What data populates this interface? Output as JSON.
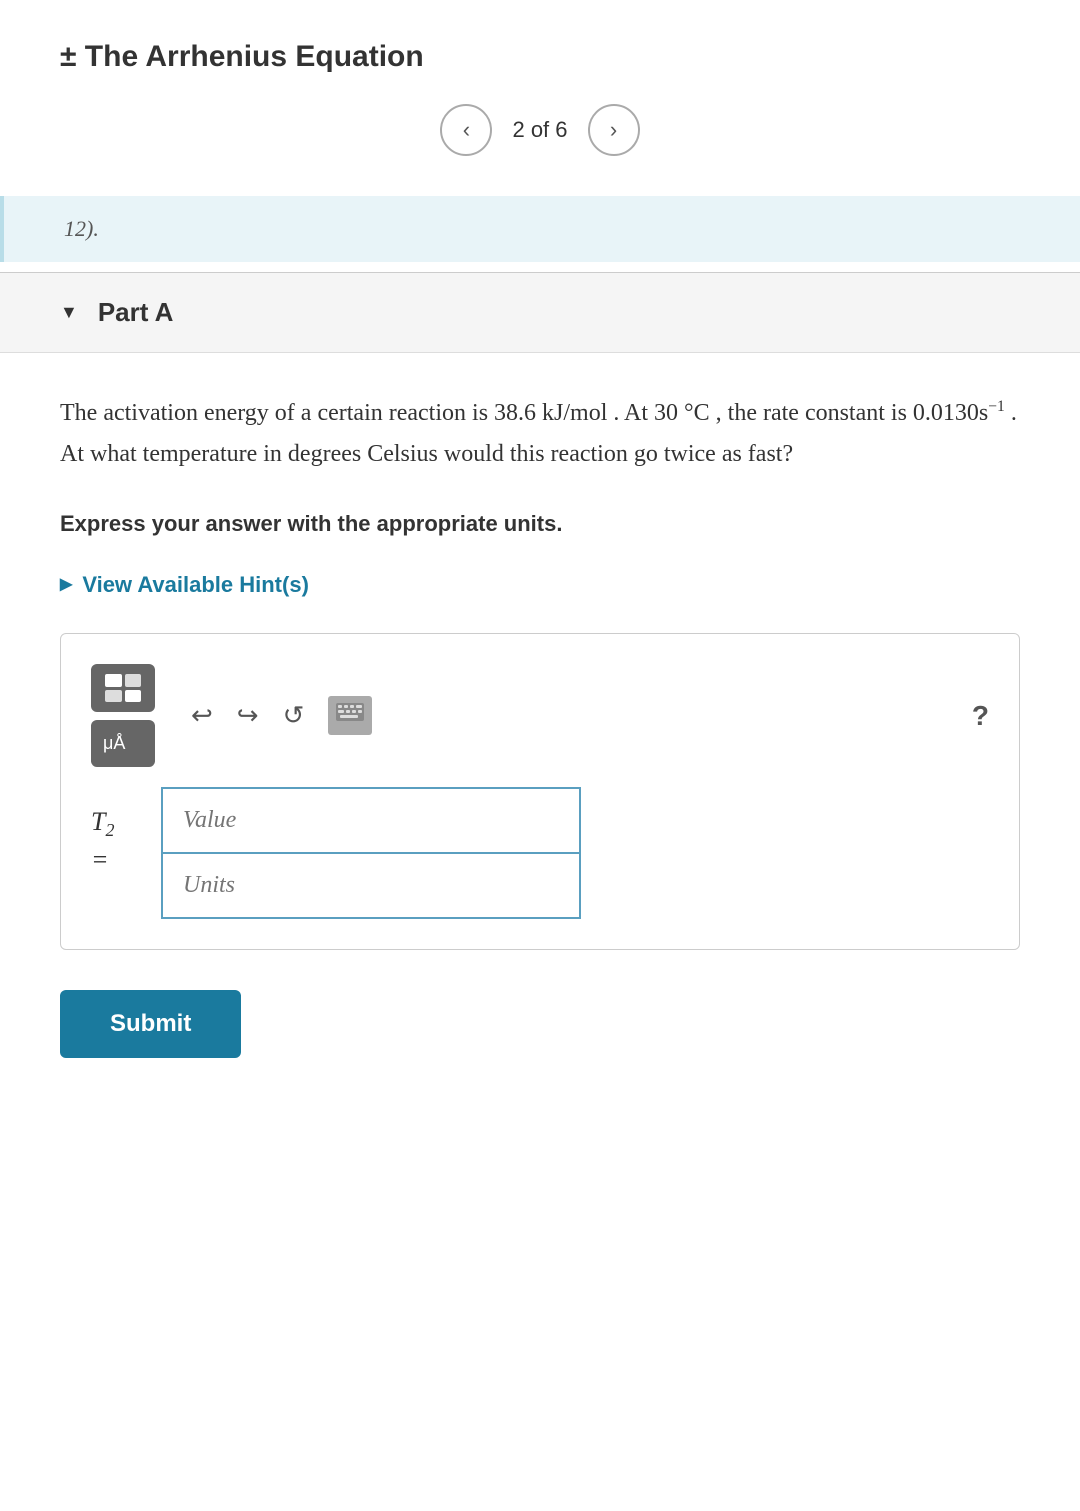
{
  "header": {
    "title": "± The Arrhenius Equation",
    "pagination": {
      "current": 2,
      "total": 6,
      "label": "2 of 6",
      "prev_label": "‹",
      "next_label": "›"
    }
  },
  "preview": {
    "text": "12)."
  },
  "part": {
    "label": "Part A",
    "question": {
      "main_text": "The activation energy of a certain reaction is 38.6 kJ/mol . At 30 °C , the rate constant is 0.0130s⁻¹ . At what temperature in degrees Celsius would this reaction go twice as fast?",
      "instruction": "Express your answer with the appropriate units.",
      "hint_label": "View Available Hint(s)"
    }
  },
  "toolbar": {
    "mu_label": "μÅ",
    "help_label": "?",
    "undo_char": "↩",
    "redo_char": "↪",
    "refresh_char": "↺"
  },
  "answer": {
    "variable": "T₂ =",
    "value_placeholder": "Value",
    "units_placeholder": "Units"
  },
  "submit": {
    "label": "Submit"
  },
  "colors": {
    "accent": "#1a7a9e",
    "toolbar_bg": "#666666",
    "input_border": "#5a9fc0",
    "hint_color": "#1a7a9e"
  }
}
